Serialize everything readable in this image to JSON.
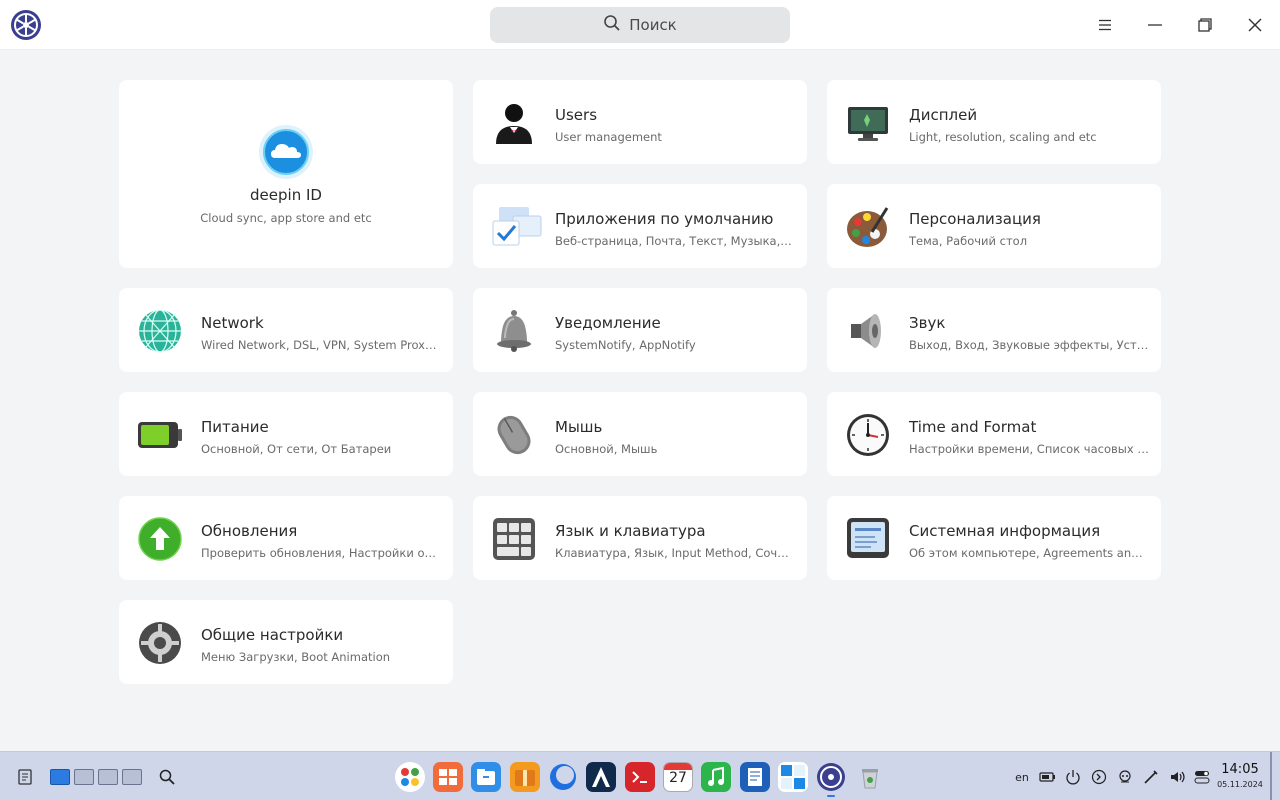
{
  "search": {
    "placeholder": "Поиск"
  },
  "titlebar": {
    "buttons": {
      "menu": "menu-icon",
      "minimize": "minimize-icon",
      "maximize": "maximize-icon",
      "close": "close-icon"
    }
  },
  "cards": [
    {
      "title": "deepin ID",
      "subtitle": "Cloud sync, app store and etc",
      "icon": "deepin-id-icon"
    },
    {
      "title": "Users",
      "subtitle": "User management",
      "icon": "users-icon"
    },
    {
      "title": "Дисплей",
      "subtitle": "Light, resolution, scaling and etc",
      "icon": "display-icon"
    },
    {
      "title": "Приложения по умолчанию",
      "subtitle": "Веб-страница, Почта, Текст, Музыка, Видео…",
      "icon": "default-apps-icon"
    },
    {
      "title": "Персонализация",
      "subtitle": "Тема, Рабочий стол",
      "icon": "personalization-icon"
    },
    {
      "title": "Network",
      "subtitle": "Wired Network, DSL, VPN, System Proxy, Net…",
      "icon": "network-icon"
    },
    {
      "title": "Уведомление",
      "subtitle": "SystemNotify, AppNotify",
      "icon": "notification-icon"
    },
    {
      "title": "Звук",
      "subtitle": "Выход, Вход, Звуковые эффекты, Устройст…",
      "icon": "sound-icon"
    },
    {
      "title": "Питание",
      "subtitle": "Основной, От сети, От Батареи",
      "icon": "power-icon"
    },
    {
      "title": "Мышь",
      "subtitle": "Основной, Мышь",
      "icon": "mouse-icon"
    },
    {
      "title": "Time and Format",
      "subtitle": "Настройки времени, Список часовых поя…",
      "icon": "clock-icon"
    },
    {
      "title": "Обновления",
      "subtitle": "Проверить обновления, Настройки обнов…",
      "icon": "update-icon"
    },
    {
      "title": "Язык и клавиатура",
      "subtitle": "Клавиатура, Язык, Input Method, Сочетани…",
      "icon": "keyboard-icon"
    },
    {
      "title": "Системная информация",
      "subtitle": "Об этом компьютере, Agreements and Priva…",
      "icon": "system-info-icon"
    },
    {
      "title": "Общие настройки",
      "subtitle": "Меню Загрузки, Boot Animation",
      "icon": "general-settings-icon"
    }
  ],
  "taskbar": {
    "left_items": [
      "notes-icon",
      "workspace-1",
      "workspace-2",
      "workspace-3",
      "workspace-4",
      "search-icon"
    ],
    "dock_apps": [
      "launcher-icon",
      "app-store-icon",
      "file-manager-icon",
      "archive-icon",
      "browser-icon",
      "terminal-alt-icon",
      "terminal-icon",
      "calendar-icon",
      "music-icon",
      "text-editor-icon",
      "multitasking-icon",
      "control-center-icon",
      "trash-icon"
    ],
    "calendar_day": "27",
    "tray": {
      "language": "en"
    },
    "clock": {
      "time": "14:05",
      "date": "05.11.2024"
    }
  },
  "colors": {
    "accent": "#2b7be0",
    "taskbar_bg": "#cfd6ea"
  }
}
